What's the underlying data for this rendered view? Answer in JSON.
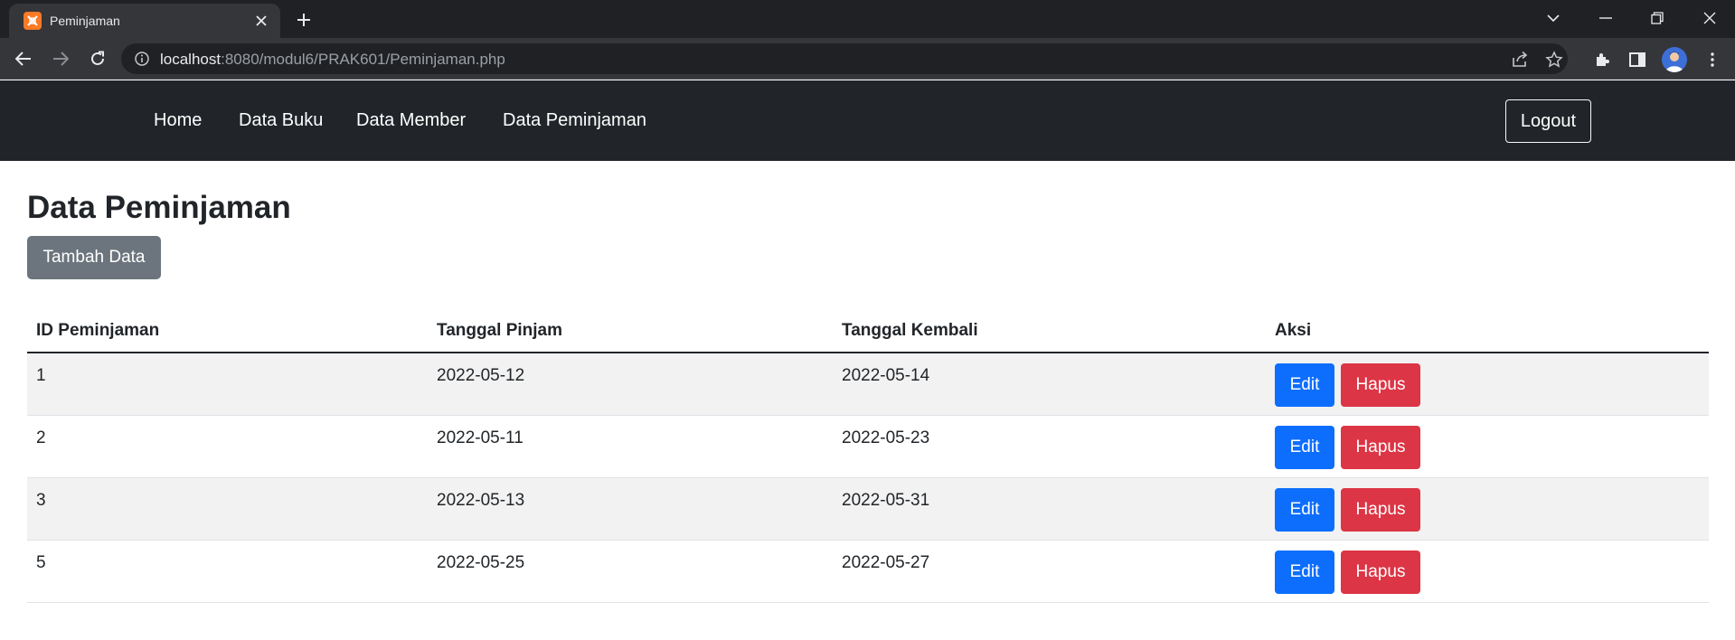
{
  "browser": {
    "tab_title": "Peminjaman",
    "url_host": "localhost",
    "url_rest": ":8080/modul6/PRAK601/Peminjaman.php"
  },
  "navbar": {
    "links": [
      "Home",
      "Data Buku",
      "Data Member",
      "Data Peminjaman"
    ],
    "logout_label": "Logout"
  },
  "main": {
    "title": "Data Peminjaman",
    "add_button_label": "Tambah Data",
    "table": {
      "headers": [
        "ID Peminjaman",
        "Tanggal Pinjam",
        "Tanggal Kembali",
        "Aksi"
      ],
      "rows": [
        {
          "id": "1",
          "tanggal_pinjam": "2022-05-12",
          "tanggal_kembali": "2022-05-14"
        },
        {
          "id": "2",
          "tanggal_pinjam": "2022-05-11",
          "tanggal_kembali": "2022-05-23"
        },
        {
          "id": "3",
          "tanggal_pinjam": "2022-05-13",
          "tanggal_kembali": "2022-05-31"
        },
        {
          "id": "5",
          "tanggal_pinjam": "2022-05-25",
          "tanggal_kembali": "2022-05-27"
        }
      ],
      "edit_label": "Edit",
      "delete_label": "Hapus"
    }
  },
  "colors": {
    "navbar_bg": "#212529",
    "primary": "#0d6efd",
    "danger": "#dc3545",
    "secondary": "#6c757d"
  }
}
